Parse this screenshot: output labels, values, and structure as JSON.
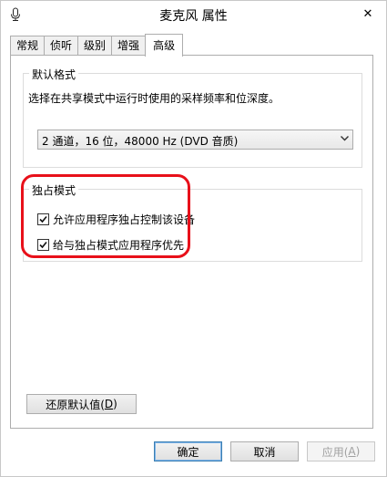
{
  "window": {
    "title": "麦克风 属性",
    "close_glyph": "✕"
  },
  "tabs": [
    {
      "label": "常规",
      "active": false
    },
    {
      "label": "侦听",
      "active": false
    },
    {
      "label": "级别",
      "active": false
    },
    {
      "label": "增强",
      "active": false
    },
    {
      "label": "高级",
      "active": true
    }
  ],
  "default_format": {
    "title": "默认格式",
    "description": "选择在共享模式中运行时使用的采样频率和位深度。",
    "selected": "2 通道，16 位，48000 Hz (DVD 音质)"
  },
  "exclusive_mode": {
    "title": "独占模式",
    "options": [
      {
        "label": "允许应用程序独占控制该设备",
        "checked": true
      },
      {
        "label": "给与独占模式应用程序优先",
        "checked": true
      }
    ]
  },
  "restore_button": {
    "label": "还原默认值(",
    "key": "D",
    "suffix": ")"
  },
  "footer": {
    "ok": "确定",
    "cancel": "取消",
    "apply_label": "应用(",
    "apply_key": "A",
    "apply_suffix": ")"
  },
  "colors": {
    "highlight": "#e8101a"
  }
}
